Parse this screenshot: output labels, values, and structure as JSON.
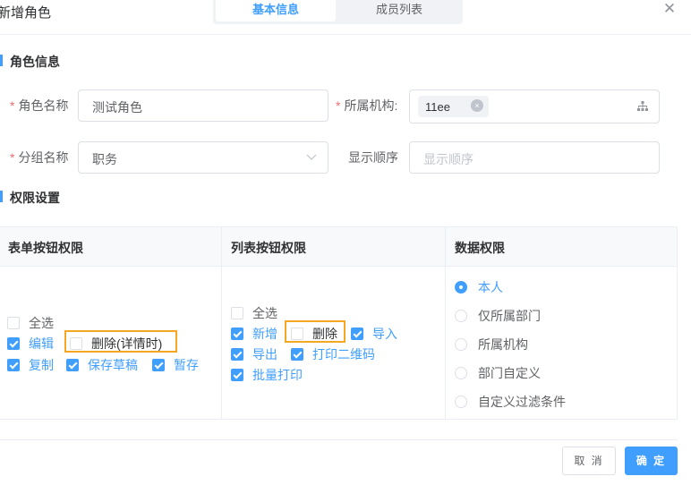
{
  "dialog": {
    "title": "新增角色",
    "close_glyph": "✕"
  },
  "tabs": [
    {
      "label": "基本信息",
      "active": true
    },
    {
      "label": "成员列表",
      "active": false
    }
  ],
  "sections": {
    "role_info": "角色信息",
    "permission": "权限设置"
  },
  "form": {
    "required_mark": "*",
    "role_name": {
      "label": "角色名称",
      "value": "测试角色"
    },
    "org": {
      "label": "所属机构:",
      "tag": "11ee",
      "tag_close": "×"
    },
    "group": {
      "label": "分组名称",
      "value": "职务"
    },
    "order": {
      "label": "显示顺序",
      "placeholder": "显示顺序"
    }
  },
  "table": {
    "headers": [
      "表单按钮权限",
      "列表按钮权限",
      "数据权限"
    ],
    "form_buttons": {
      "select_all": {
        "label": "全选",
        "checked": false
      },
      "items": [
        {
          "label": "编辑",
          "checked": true
        },
        {
          "label": "删除(详情时)",
          "checked": false,
          "highlighted": true
        },
        {
          "label": "复制",
          "checked": true
        },
        {
          "label": "保存草稿",
          "checked": true
        },
        {
          "label": "暂存",
          "checked": true
        }
      ]
    },
    "list_buttons": {
      "select_all": {
        "label": "全选",
        "checked": false
      },
      "items": [
        {
          "label": "新增",
          "checked": true
        },
        {
          "label": "删除",
          "checked": false,
          "highlighted": true
        },
        {
          "label": "导入",
          "checked": true
        },
        {
          "label": "导出",
          "checked": true
        },
        {
          "label": "打印二维码",
          "checked": true
        },
        {
          "label": "批量打印",
          "checked": true
        }
      ]
    },
    "data_scope": {
      "options": [
        {
          "label": "本人",
          "selected": true
        },
        {
          "label": "仅所属部门",
          "selected": false
        },
        {
          "label": "所属机构",
          "selected": false
        },
        {
          "label": "部门自定义",
          "selected": false
        },
        {
          "label": "自定义过滤条件",
          "selected": false
        }
      ]
    }
  },
  "footer": {
    "cancel": "取 消",
    "confirm": "确 定"
  },
  "colors": {
    "primary": "#409eff",
    "highlight_border": "#f5a623",
    "required": "#f56c6c"
  }
}
